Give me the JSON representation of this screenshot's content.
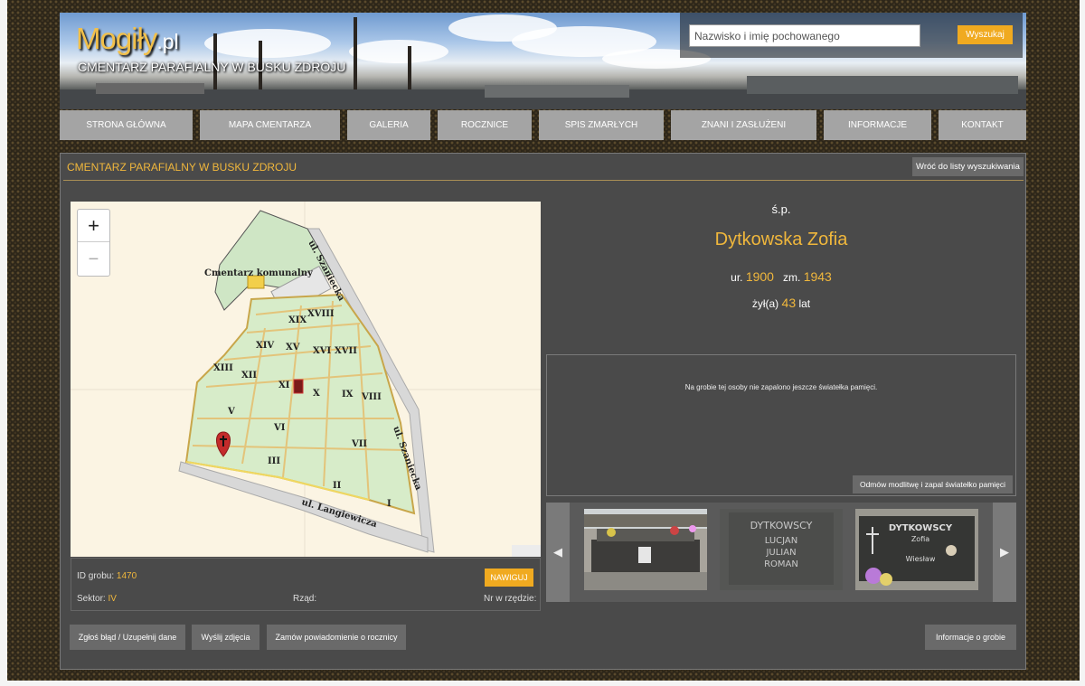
{
  "site": {
    "logo_main": "Mogiły",
    "logo_suffix": ".pl",
    "subtitle": "CMENTARZ PARAFIALNY W BUSKU ZDROJU"
  },
  "search": {
    "placeholder": "Nazwisko i imię pochowanego",
    "button_label": "Wyszukaj"
  },
  "nav": [
    "STRONA GŁÓWNA",
    "MAPA CMENTARZA",
    "GALERIA",
    "ROCZNICE",
    "SPIS ZMARŁYCH",
    "ZNANI I ZASŁUŻENI",
    "INFORMACJE",
    "KONTAKT"
  ],
  "page": {
    "title": "CMENTARZ PARAFIALNY W BUSKU ZDROJU",
    "back_button": "Wróć do listy wyszukiwania"
  },
  "map": {
    "zoom_in": "+",
    "zoom_out": "−",
    "cemetery_label": "Cmentarz komunalny",
    "streets": [
      "ul. Szaniecka",
      "ul. Szaniecka",
      "ul. Langiewicza"
    ],
    "sectors": [
      "XIX",
      "XVIII",
      "XIV",
      "XV",
      "XVI",
      "XVII",
      "XIII",
      "XII",
      "XI",
      "X",
      "IX",
      "VIII",
      "V",
      "VI",
      "VII",
      "III",
      "II",
      "I"
    ],
    "marker_icon": "cross-pin-icon"
  },
  "grave": {
    "id_label": "ID grobu:",
    "id_value": "1470",
    "sector_label": "Sektor:",
    "sector_value": "IV",
    "row_label": "Rząd:",
    "row_value": "",
    "nr_label": "Nr w rzędzie:",
    "nr_value": "",
    "navigate_button": "NAWIGUJ"
  },
  "person": {
    "prefix": "ś.p.",
    "name": "Dytkowska Zofia",
    "born_label": "ur.",
    "born": "1900",
    "died_label": "zm.",
    "died": "1943",
    "age_label": "żył(a)",
    "age": "43",
    "age_unit": "lat"
  },
  "candles": {
    "message": "Na grobie tej osoby nie zapalono jeszcze światełka pamięci.",
    "button": "Odmów modlitwę i zapal światełko pamięci"
  },
  "gallery": {
    "prev": "◀",
    "next": "▶",
    "photo_texts": {
      "p2": [
        "DYTKOWSCY",
        "LUCJAN",
        "JULIAN",
        "ROMAN"
      ],
      "p3": [
        "DYTKOWSCY",
        "Zofia",
        "Wiesław"
      ]
    }
  },
  "actions": {
    "report": "Zgłoś błąd / Uzupełnij dane",
    "send_photos": "Wyślij zdjęcia",
    "anniversary": "Zamów powiadomienie o rocznicy",
    "grave_info": "Informacje o grobie"
  },
  "colors": {
    "accent": "#f0b73c",
    "button_orange": "#f0aa20",
    "panel": "#4a4a4a",
    "nav": "#a4a4a4"
  }
}
